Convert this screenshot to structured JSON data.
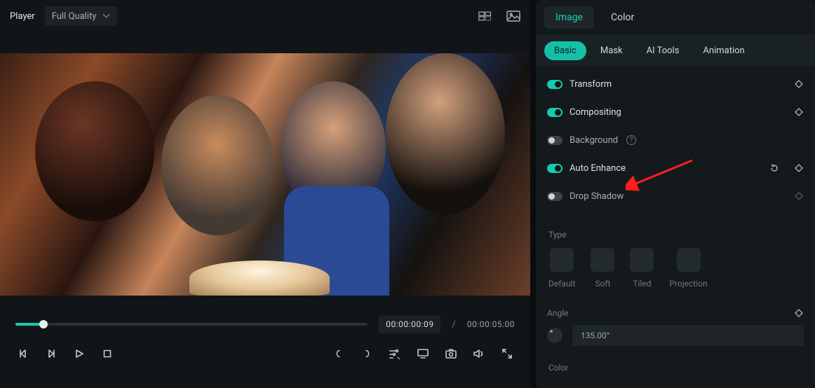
{
  "player": {
    "title": "Player",
    "quality_label": "Full Quality",
    "time_current": "00:00:00:09",
    "time_sep": "/",
    "time_total": "00:00:05:00",
    "seek_percent": 8
  },
  "tabs_primary": {
    "image": "Image",
    "color": "Color",
    "active": "image"
  },
  "tabs_secondary": {
    "basic": "Basic",
    "mask": "Mask",
    "ai": "AI Tools",
    "animation": "Animation",
    "active": "basic"
  },
  "rows": {
    "transform": {
      "label": "Transform",
      "on": true,
      "keyframe": true
    },
    "compositing": {
      "label": "Compositing",
      "on": true,
      "keyframe": true
    },
    "background": {
      "label": "Background",
      "on": false,
      "help": true
    },
    "autoenhance": {
      "label": "Auto Enhance",
      "on": true,
      "reset": true,
      "keyframe": true
    },
    "dropshadow": {
      "label": "Drop Shadow",
      "on": false,
      "keyframe_dim": true
    }
  },
  "dropshadow_section": {
    "type_label": "Type",
    "tiles": {
      "default": "Default",
      "soft": "Soft",
      "tiled": "Tiled",
      "projection": "Projection"
    },
    "angle_label": "Angle",
    "angle_value": "135.00°",
    "color_label": "Color"
  },
  "icons": {
    "compare": "compare-icon",
    "snapshot_header": "image-icon",
    "prev_frame": "prev-frame-icon",
    "next_frame": "next-frame-icon",
    "play": "play-icon",
    "stop": "stop-icon",
    "mark_in": "mark-in-icon",
    "mark_out": "mark-out-icon",
    "zoom_menu": "zoom-menu-icon",
    "display": "display-icon",
    "snapshot": "snapshot-icon",
    "volume": "volume-icon",
    "fullscreen": "fullscreen-icon"
  },
  "colors": {
    "accent": "#16c9b0",
    "arrow": "#ff1e1e"
  }
}
